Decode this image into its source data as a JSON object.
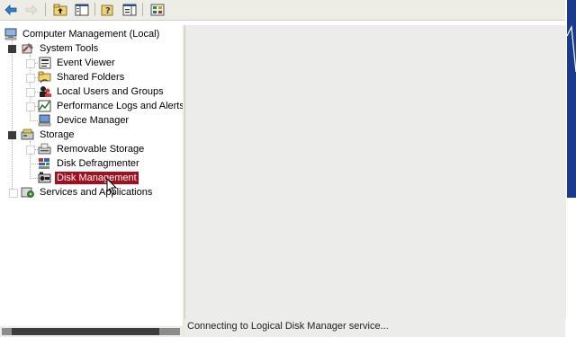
{
  "toolbar": {
    "buttons": [
      {
        "name": "back-button",
        "icon": "back-arrow-icon"
      },
      {
        "name": "forward-button",
        "icon": "forward-arrow-icon"
      },
      {
        "name": "up-one-level-button",
        "icon": "folder-up-icon"
      },
      {
        "name": "show-hide-tree-button",
        "icon": "console-tree-icon"
      },
      {
        "name": "help-button",
        "icon": "help-icon"
      },
      {
        "name": "action-pane-button",
        "icon": "action-pane-icon"
      },
      {
        "name": "properties-button",
        "icon": "properties-icon"
      }
    ]
  },
  "tree": {
    "root": "Computer Management (Local)",
    "system_tools": "System Tools",
    "event_viewer": "Event Viewer",
    "shared_folders": "Shared Folders",
    "local_users": "Local Users and Groups",
    "perf_logs": "Performance Logs and Alerts",
    "device_manager": "Device Manager",
    "storage": "Storage",
    "removable_storage": "Removable Storage",
    "disk_defrag": "Disk Defragmenter",
    "disk_management": "Disk Management",
    "services_apps": "Services and Applications"
  },
  "status": {
    "text": "Connecting to Logical Disk Manager service..."
  },
  "colors": {
    "selection": "#a50e1e",
    "toolbar_bg": "#eeede5",
    "pane_bg": "#ececea"
  }
}
